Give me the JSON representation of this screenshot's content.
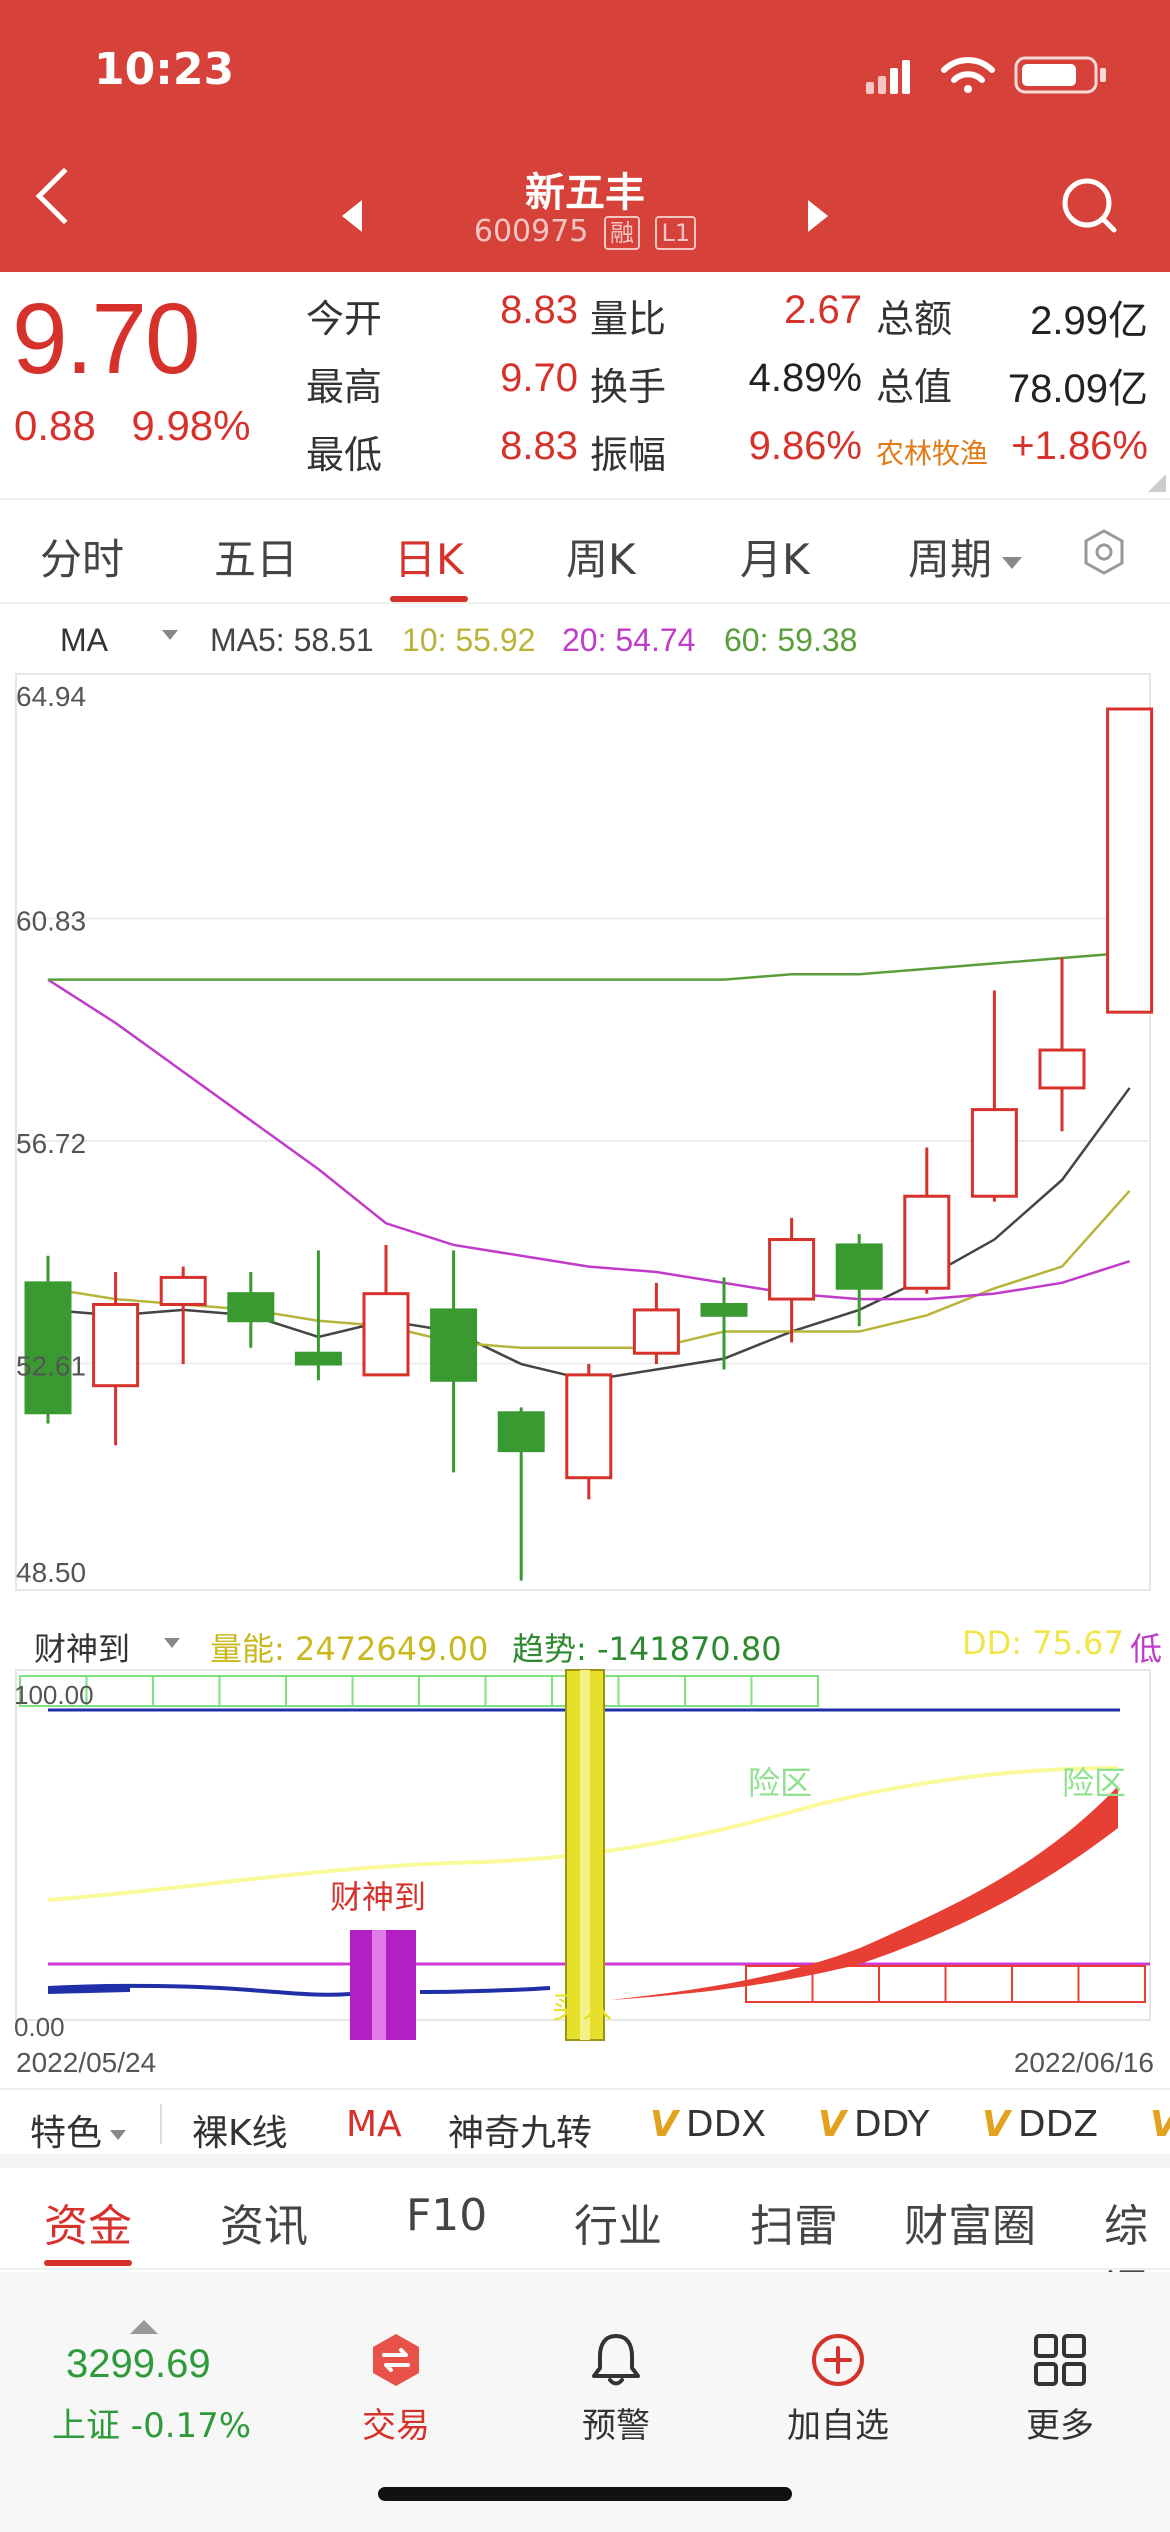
{
  "status": {
    "time": "10:23"
  },
  "header": {
    "name": "新五丰",
    "code": "600975",
    "tag1": "融",
    "tag2": "L1"
  },
  "quote": {
    "price": "9.70",
    "change": "0.88",
    "change_pct": "9.98%",
    "rows": [
      {
        "l1": "今开",
        "v1": "8.83",
        "l2": "量比",
        "v2": "2.67",
        "l3": "总额",
        "v3": "2.99亿"
      },
      {
        "l1": "最高",
        "v1": "9.70",
        "l2": "换手",
        "v2": "4.89%",
        "l3": "总值",
        "v3": "78.09亿"
      },
      {
        "l1": "最低",
        "v1": "8.83",
        "l2": "振幅",
        "v2": "9.86%",
        "l3": "农林牧渔",
        "v3": "+1.86%"
      }
    ]
  },
  "period_tabs": [
    "分时",
    "五日",
    "日K",
    "周K",
    "月K",
    "周期"
  ],
  "ma_legend": {
    "type": "MA",
    "ma5": "MA5: 58.51",
    "ma10": "10: 55.92",
    "ma20": "20: 54.74",
    "ma60": "60: 59.38"
  },
  "colors": {
    "header_red": "#d6413a",
    "up": "#d6312b",
    "down": "#3a9a32",
    "ma5": "#444444",
    "ma10": "#b8b43a",
    "ma20": "#c03bc8",
    "ma60": "#5a9e3c"
  },
  "chart_data": [
    {
      "type": "candlestick",
      "y_ticks": [
        "64.94",
        "60.83",
        "56.72",
        "52.61",
        "48.50"
      ],
      "ylim": [
        48.5,
        64.94
      ],
      "candles": [
        {
          "open": 54.1,
          "close": 51.7,
          "high": 54.6,
          "low": 51.5
        },
        {
          "open": 52.2,
          "close": 53.7,
          "high": 54.3,
          "low": 51.1
        },
        {
          "open": 53.7,
          "close": 54.2,
          "high": 54.4,
          "low": 52.6
        },
        {
          "open": 53.9,
          "close": 53.4,
          "high": 54.3,
          "low": 52.9
        },
        {
          "open": 52.8,
          "close": 52.6,
          "high": 54.7,
          "low": 52.3
        },
        {
          "open": 52.4,
          "close": 53.9,
          "high": 54.8,
          "low": 52.4
        },
        {
          "open": 53.6,
          "close": 52.3,
          "high": 54.7,
          "low": 50.6
        },
        {
          "open": 51.7,
          "close": 51.0,
          "high": 51.8,
          "low": 48.6
        },
        {
          "open": 50.5,
          "close": 52.4,
          "high": 52.6,
          "low": 50.1
        },
        {
          "open": 52.8,
          "close": 53.6,
          "high": 54.1,
          "low": 52.6
        },
        {
          "open": 53.7,
          "close": 53.5,
          "high": 54.2,
          "low": 52.5
        },
        {
          "open": 53.8,
          "close": 54.9,
          "high": 55.3,
          "low": 53.0
        },
        {
          "open": 54.8,
          "close": 54.0,
          "high": 55.0,
          "low": 53.3
        },
        {
          "open": 54.0,
          "close": 55.7,
          "high": 56.6,
          "low": 53.9
        },
        {
          "open": 55.7,
          "close": 57.3,
          "high": 59.5,
          "low": 55.6
        },
        {
          "open": 57.7,
          "close": 58.4,
          "high": 60.1,
          "low": 56.9
        },
        {
          "open": 59.1,
          "close": 64.7,
          "high": 64.7,
          "low": 59.1
        }
      ],
      "series": [
        {
          "name": "MA5",
          "values": [
            53.6,
            53.5,
            53.6,
            53.5,
            53.1,
            53.4,
            53.2,
            52.6,
            52.3,
            52.5,
            52.7,
            53.2,
            53.6,
            54.2,
            54.9,
            56.0,
            57.7
          ]
        },
        {
          "name": "10",
          "values": [
            54.0,
            53.8,
            53.7,
            53.6,
            53.4,
            53.3,
            53.0,
            52.9,
            52.9,
            52.9,
            53.2,
            53.2,
            53.2,
            53.5,
            54.0,
            54.4,
            55.8
          ]
        },
        {
          "name": "20",
          "values": [
            59.7,
            58.9,
            58.0,
            57.1,
            56.2,
            55.2,
            54.8,
            54.6,
            54.4,
            54.3,
            54.1,
            53.9,
            53.8,
            53.8,
            53.9,
            54.1,
            54.5
          ]
        },
        {
          "name": "60",
          "values": [
            59.7,
            59.7,
            59.7,
            59.7,
            59.7,
            59.7,
            59.7,
            59.7,
            59.7,
            59.7,
            59.7,
            59.8,
            59.8,
            59.9,
            60.0,
            60.1,
            60.2
          ]
        }
      ]
    },
    {
      "type": "indicator",
      "y_ticks": [
        "100.00",
        "0.00"
      ],
      "dates": [
        "2022/05/24",
        "2022/06/16"
      ],
      "labels": {
        "signal": "财神到",
        "zone1": "险区",
        "zone2": "险区",
        "buy": "买入"
      }
    }
  ],
  "indicator_bar": {
    "name": "财神到",
    "volume": "量能: 2472649.00",
    "trend": "趋势: -141870.80",
    "dd": "DD: 75.67",
    "trail": "低"
  },
  "indicator_tabs": [
    "特色",
    "裸K线",
    "MA",
    "神奇九转",
    "DDX",
    "DDY",
    "DDZ",
    "V"
  ],
  "info_tabs": [
    "资金",
    "资讯",
    "F10",
    "行业",
    "扫雷",
    "财富圈",
    "综评"
  ],
  "bottom": {
    "index_value": "3299.69",
    "index_label": "上证 -0.17%",
    "items": [
      "交易",
      "预警",
      "加自选",
      "更多"
    ]
  }
}
